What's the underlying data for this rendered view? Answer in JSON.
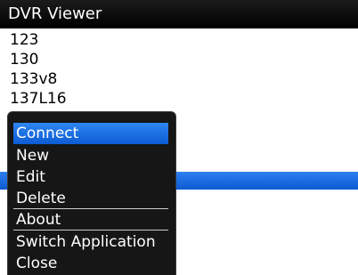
{
  "title_bar": {
    "title": "DVR Viewer"
  },
  "list": {
    "items": [
      "123",
      "130",
      "133v8",
      "137L16"
    ]
  },
  "menu": {
    "items": [
      {
        "label": "Connect",
        "selected": true
      },
      {
        "label": "New"
      },
      {
        "label": "Edit"
      },
      {
        "label": "Delete"
      },
      {
        "label": "About"
      },
      {
        "label": "Switch Application"
      },
      {
        "label": "Close"
      }
    ]
  },
  "colors": {
    "title_bar": "#000000",
    "selection": "#1565e0",
    "menu_background": "#161616"
  }
}
